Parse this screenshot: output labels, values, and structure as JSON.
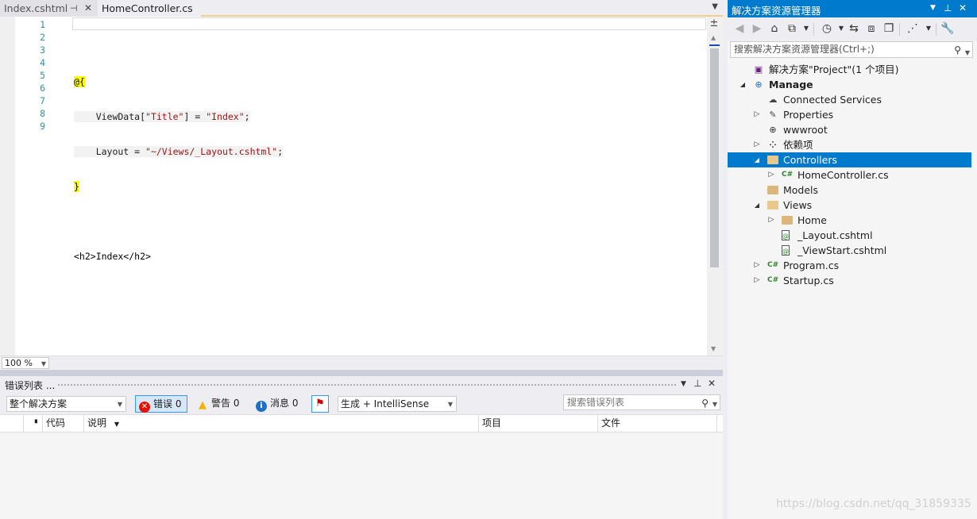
{
  "editor": {
    "tabs": [
      {
        "label": "Index.cshtml",
        "pin_icon": "pin-icon",
        "close_icon": "close-icon"
      },
      {
        "label": "HomeController.cs"
      }
    ],
    "line_numbers": [
      "1",
      "2",
      "3",
      "4",
      "5",
      "6",
      "7",
      "8",
      "9"
    ],
    "code_lines": [
      "",
      "@{",
      "    ViewData[\"Title\"] = \"Index\";",
      "    Layout = \"~/Views/_Layout.cshtml\";",
      "}",
      "",
      "<h2>Index</h2>",
      "",
      ""
    ],
    "zoom": "100 %"
  },
  "error_list": {
    "title": "错误列表 ...",
    "scope": "整个解决方案",
    "errors_label": "错误 0",
    "warnings_label": "警告 0",
    "messages_label": "消息 0",
    "build_filter": "生成 + IntelliSense",
    "search_placeholder": "搜索错误列表",
    "columns": [
      "代码",
      "说明",
      "项目",
      "文件"
    ]
  },
  "solution_explorer": {
    "title": "解决方案资源管理器",
    "search_placeholder": "搜索解决方案资源管理器(Ctrl+;)",
    "tree": [
      {
        "label": "解决方案\"Project\"(1 个项目)",
        "icon": "solution-icon",
        "depth": 0,
        "arrow": ""
      },
      {
        "label": "Manage",
        "icon": "web-project-icon",
        "depth": 0,
        "arrow": "expanded",
        "bold": true
      },
      {
        "label": "Connected Services",
        "icon": "cloud-icon",
        "depth": 1,
        "arrow": ""
      },
      {
        "label": "Properties",
        "icon": "wrench-icon",
        "depth": 1,
        "arrow": "collapsed"
      },
      {
        "label": "wwwroot",
        "icon": "globe-icon",
        "depth": 1,
        "arrow": ""
      },
      {
        "label": "依赖项",
        "icon": "dependencies-icon",
        "depth": 1,
        "arrow": "collapsed"
      },
      {
        "label": "Controllers",
        "icon": "folder-open-icon",
        "depth": 1,
        "arrow": "expanded",
        "selected": true
      },
      {
        "label": "HomeController.cs",
        "icon": "csharp-file-icon",
        "depth": 2,
        "arrow": "collapsed"
      },
      {
        "label": "Models",
        "icon": "folder-icon",
        "depth": 1,
        "arrow": ""
      },
      {
        "label": "Views",
        "icon": "folder-open-icon",
        "depth": 1,
        "arrow": "expanded"
      },
      {
        "label": "Home",
        "icon": "folder-icon",
        "depth": 2,
        "arrow": "collapsed"
      },
      {
        "label": "_Layout.cshtml",
        "icon": "razor-file-icon",
        "depth": 2,
        "arrow": ""
      },
      {
        "label": "_ViewStart.cshtml",
        "icon": "razor-file-icon",
        "depth": 2,
        "arrow": ""
      },
      {
        "label": "Program.cs",
        "icon": "csharp-file-icon",
        "depth": 1,
        "arrow": "collapsed"
      },
      {
        "label": "Startup.cs",
        "icon": "csharp-file-icon",
        "depth": 1,
        "arrow": "collapsed"
      }
    ]
  },
  "watermark": "https://blog.csdn.net/qq_31859335",
  "colors": {
    "accent": "#007acc",
    "razor_highlight": "#ffff00",
    "string": "#a31515",
    "line_number": "#2b91af"
  }
}
